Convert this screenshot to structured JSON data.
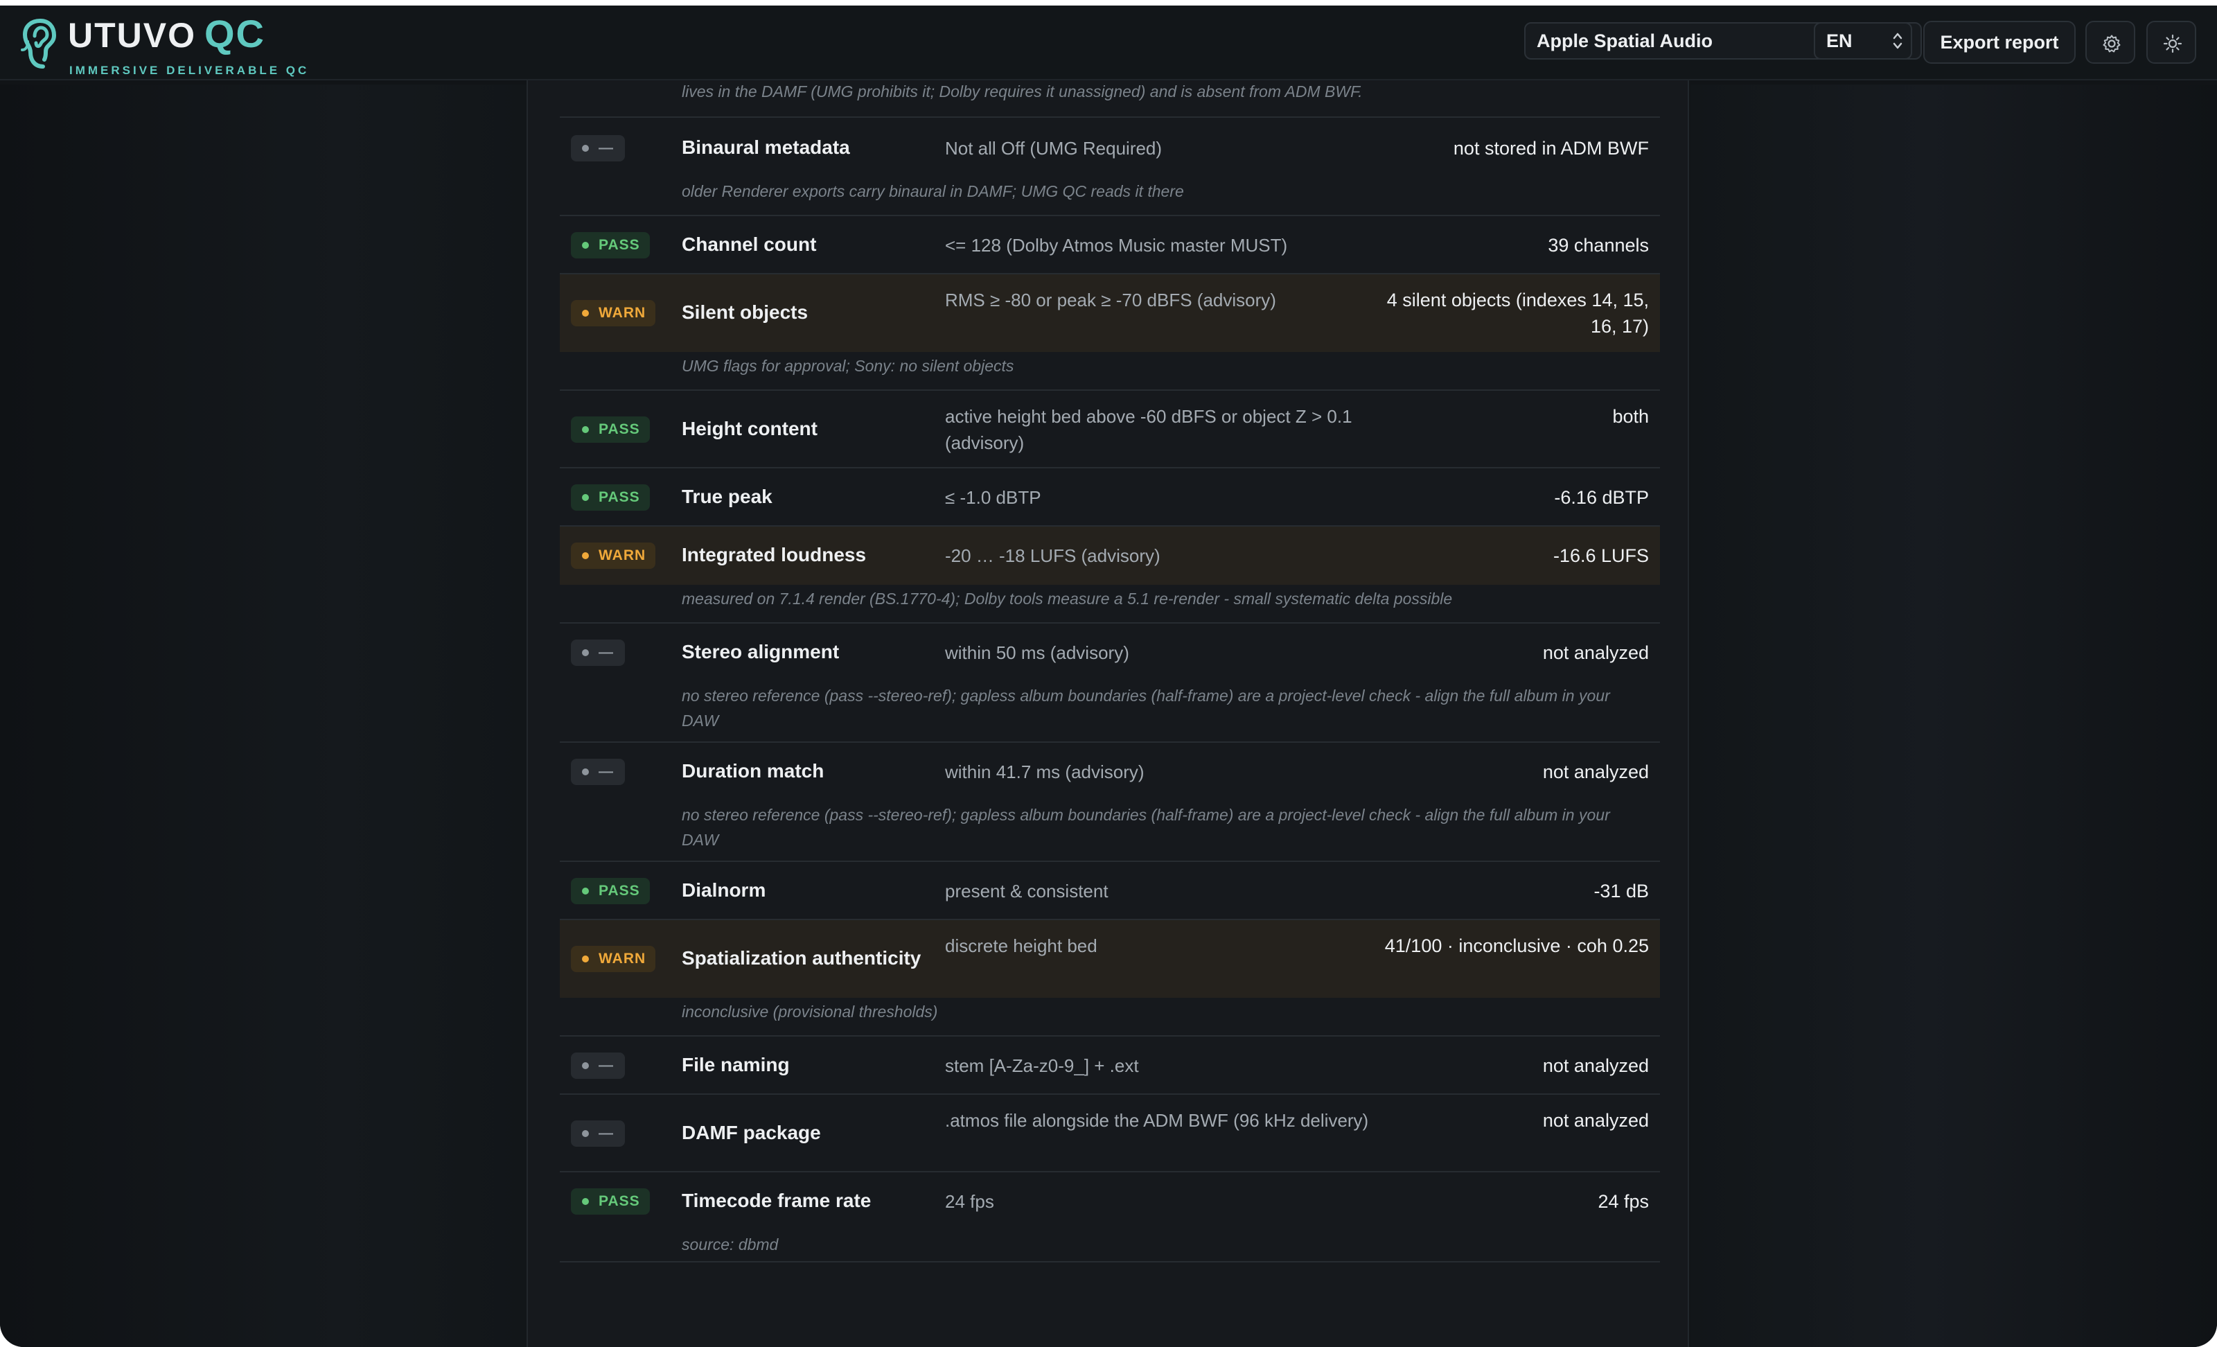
{
  "app": {
    "logo_word": "UTUVO",
    "logo_qc": "QC",
    "tagline": "IMMERSIVE DELIVERABLE QC"
  },
  "toolbar": {
    "delivery_target": "Apple Spatial Audio",
    "language": "EN",
    "export_label": "Export report",
    "settings_icon": "gear-icon",
    "theme_icon": "sun-icon"
  },
  "colors": {
    "accent": "#5fc9c0",
    "pass": "#65c97a",
    "warn": "#f0a93a",
    "neutral": "#8e959c"
  },
  "checks": {
    "top_note": "audioProgramme starts at a non-zero timecode - usually a leftover from exporting the master at its album-timeline position instead of 00:00:00. Re-export (or trim) so the track starts at zero, and verify alignment against the stereo master. Note this is not FFOA: FFOA lives in the DAMF (UMG prohibits it; Dolby requires it unassigned) and is absent from ADM BWF.",
    "rows": [
      {
        "status": "—",
        "name": "Binaural metadata",
        "requirement": "Not all Off (UMG Required)",
        "result": "not stored in ADM BWF",
        "note": "older Renderer exports carry binaural in DAMF; UMG QC reads it there"
      },
      {
        "status": "PASS",
        "name": "Channel count",
        "requirement": "<= 128 (Dolby Atmos Music master MUST)",
        "result": "39 channels",
        "note": ""
      },
      {
        "status": "WARN",
        "name": "Silent objects",
        "requirement": "RMS ≥ -80 or peak ≥ -70 dBFS (advisory)",
        "result": "4 silent objects (indexes 14, 15, 16, 17)",
        "note": "UMG flags for approval; Sony: no silent objects"
      },
      {
        "status": "PASS",
        "name": "Height content",
        "requirement": "active height bed above -60 dBFS or object Z > 0.1 (advisory)",
        "result": "both",
        "note": ""
      },
      {
        "status": "PASS",
        "name": "True peak",
        "requirement": "≤ -1.0 dBTP",
        "result": "-6.16 dBTP",
        "note": ""
      },
      {
        "status": "WARN",
        "name": "Integrated loudness",
        "requirement": "-20 … -18 LUFS (advisory)",
        "result": "-16.6 LUFS",
        "note": "measured on 7.1.4 render (BS.1770-4); Dolby tools measure a 5.1 re-render - small systematic delta possible"
      },
      {
        "status": "—",
        "name": "Stereo alignment",
        "requirement": "within 50 ms (advisory)",
        "result": "not analyzed",
        "note": "no stereo reference (pass --stereo-ref); gapless album boundaries (half-frame) are a project-level check - align the full album in your DAW"
      },
      {
        "status": "—",
        "name": "Duration match",
        "requirement": "within 41.7 ms (advisory)",
        "result": "not analyzed",
        "note": "no stereo reference (pass --stereo-ref); gapless album boundaries (half-frame) are a project-level check - align the full album in your DAW"
      },
      {
        "status": "PASS",
        "name": "Dialnorm",
        "requirement": "present & consistent",
        "result": "-31 dB",
        "note": ""
      },
      {
        "status": "WARN",
        "name": "Spatialization authenticity",
        "requirement": "discrete height bed",
        "result": "41/100 · inconclusive · coh 0.25",
        "note": "inconclusive (provisional thresholds)"
      },
      {
        "status": "—",
        "name": "File naming",
        "requirement": "stem [A-Za-z0-9_] + .ext",
        "result": "not analyzed",
        "note": ""
      },
      {
        "status": "—",
        "name": "DAMF package",
        "requirement": ".atmos file alongside the ADM BWF (96 kHz delivery)",
        "result": "not analyzed",
        "note": ""
      },
      {
        "status": "PASS",
        "name": "Timecode frame rate",
        "requirement": "24 fps",
        "result": "24 fps",
        "note": "source: dbmd"
      }
    ]
  }
}
